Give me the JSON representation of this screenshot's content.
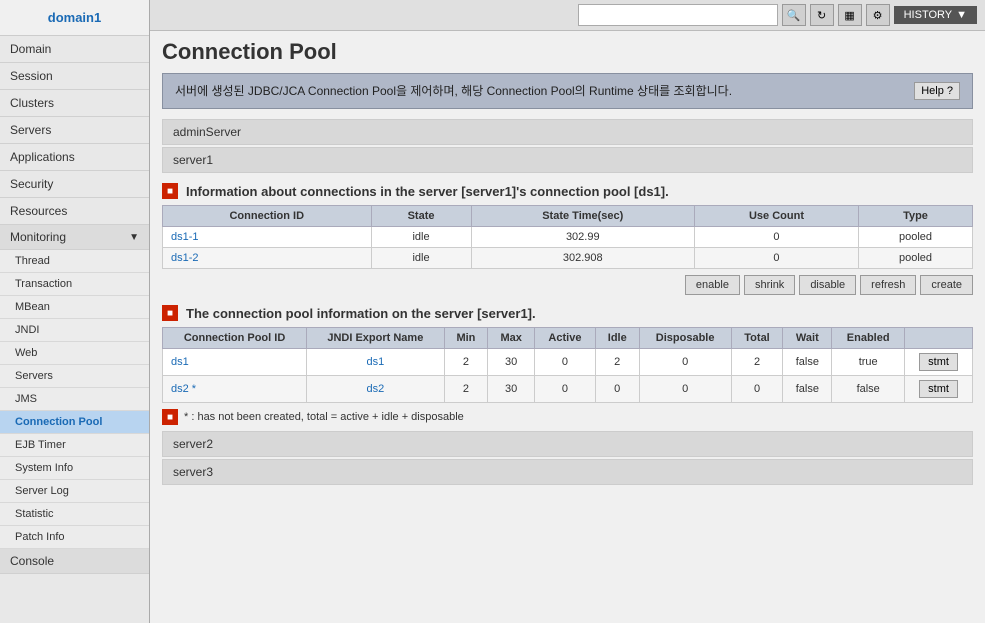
{
  "sidebar": {
    "domain_label": "domain1",
    "items": [
      {
        "id": "domain",
        "label": "Domain"
      },
      {
        "id": "session",
        "label": "Session"
      },
      {
        "id": "clusters",
        "label": "Clusters"
      },
      {
        "id": "servers",
        "label": "Servers"
      },
      {
        "id": "applications",
        "label": "Applications"
      },
      {
        "id": "security",
        "label": "Security"
      },
      {
        "id": "resources",
        "label": "Resources"
      }
    ],
    "monitoring": {
      "label": "Monitoring",
      "sub_items": [
        {
          "id": "thread",
          "label": "Thread"
        },
        {
          "id": "transaction",
          "label": "Transaction"
        },
        {
          "id": "mbean",
          "label": "MBean"
        },
        {
          "id": "jndi",
          "label": "JNDI"
        },
        {
          "id": "web",
          "label": "Web"
        },
        {
          "id": "servers",
          "label": "Servers"
        },
        {
          "id": "jms",
          "label": "JMS"
        },
        {
          "id": "connection_pool",
          "label": "Connection Pool"
        },
        {
          "id": "ejb_timer",
          "label": "EJB Timer"
        },
        {
          "id": "system_info",
          "label": "System Info"
        },
        {
          "id": "server_log",
          "label": "Server Log"
        },
        {
          "id": "statistic",
          "label": "Statistic"
        },
        {
          "id": "patch_info",
          "label": "Patch Info"
        }
      ]
    },
    "console": {
      "label": "Console"
    }
  },
  "topbar": {
    "history_label": "HISTORY",
    "search_placeholder": ""
  },
  "page": {
    "title": "Connection Pool",
    "banner_text": "서버에 생성된 JDBC/JCA Connection Pool을 제어하며, 해당 Connection Pool의 Runtime 상태를 조회합니다.",
    "help_label": "Help ?"
  },
  "servers": {
    "admin": "adminServer",
    "server1": "server1",
    "server2": "server2",
    "server3": "server3"
  },
  "connections_section": {
    "title": "Information about connections in the server [server1]'s connection pool [ds1].",
    "columns": [
      "Connection ID",
      "State",
      "State Time(sec)",
      "Use Count",
      "Type"
    ],
    "rows": [
      {
        "id": "ds1-1",
        "state": "idle",
        "time": "302.99",
        "use_count": "0",
        "type": "pooled"
      },
      {
        "id": "ds1-2",
        "state": "idle",
        "time": "302.908",
        "use_count": "0",
        "type": "pooled"
      }
    ],
    "buttons": [
      "enable",
      "shrink",
      "disable",
      "refresh",
      "create"
    ]
  },
  "pool_section": {
    "title": "The connection pool information on the server [server1].",
    "columns": [
      "Connection Pool ID",
      "JNDI Export Name",
      "Min",
      "Max",
      "Active",
      "Idle",
      "Disposable",
      "Total",
      "Wait",
      "Enabled"
    ],
    "rows": [
      {
        "id": "ds1",
        "jndi": "ds1",
        "min": "2",
        "max": "30",
        "active": "0",
        "idle": "2",
        "disposable": "0",
        "total": "2",
        "wait": "false",
        "enabled": "true",
        "stmt": "stmt"
      },
      {
        "id": "ds2 *",
        "jndi": "ds2",
        "min": "2",
        "max": "30",
        "active": "0",
        "idle": "0",
        "disposable": "0",
        "total": "0",
        "wait": "false",
        "enabled": "false",
        "stmt": "stmt"
      }
    ],
    "note": "* : has not been created, total = active + idle + disposable"
  }
}
